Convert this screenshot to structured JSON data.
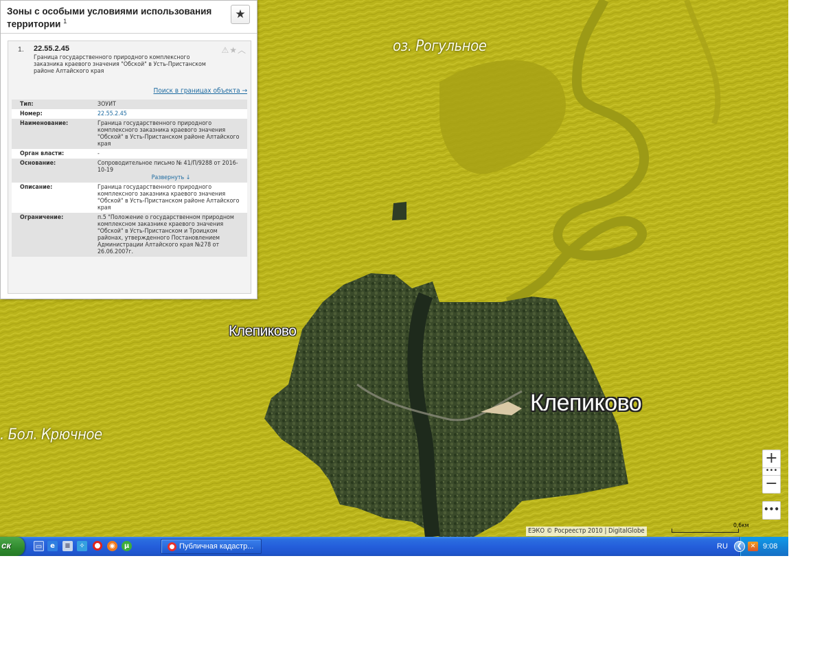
{
  "panel": {
    "title": "Зоны с особыми условиями использования территории",
    "title_sup": "1",
    "star_icon": "star-icon",
    "item": {
      "index": "1.",
      "code": "22.55.2.45",
      "description": "Граница государственного природного комплексного заказника краевого значения \"Обской\" в Усть-Пристанском районе Алтайского края",
      "search_link": "Поиск в границах объекта →",
      "icons": [
        "warning-icon",
        "star-icon",
        "chevron-up-icon"
      ],
      "fields": {
        "type_label": "Тип:",
        "type_value": "ЗОУИТ",
        "number_label": "Номер:",
        "number_value": "22.55.2.45",
        "name_label": "Наименование:",
        "name_value": "Граница государственного природного комплексного заказника краевого значения \"Обской\" в Усть-Пристанском районе Алтайского края",
        "authority_label": "Орган власти:",
        "authority_value": "-",
        "basis_label": "Основание:",
        "basis_value": "Сопроводительное письмо № 41/П/9288 от 2016-10-19",
        "expand_label": "Развернуть ↓",
        "description_label": "Описание:",
        "description_value": "Граница государственного природного комплексного заказника краевого значения \"Обской\" в Усть-Пристанском районе Алтайского края",
        "restriction_label": "Ограничение:",
        "restriction_value": "п.5 \"Положение о государственном природном комплексном заказнике краевого значения \"Обской\" в Усть-Пристанском и Троицком районах, утвержденного Постановлением Администрации Алтайского края №278 от 26.06.2007г."
      }
    }
  },
  "map": {
    "labels": {
      "lake_rogulnoe": "оз. Рогульное",
      "lake_kryuchnoe": ". Бол. Крючное",
      "village_small": "Клепиково",
      "village_large": "Клепиково"
    },
    "controls": {
      "zoom_in": "+",
      "zoom_dots": "•••",
      "zoom_out": "−",
      "more": "•••"
    },
    "copyright": "ЕЭКО © Росреестр 2010 | DigitalGlobe",
    "scale_label": "0,6км",
    "colors": {
      "zone_fill": "#b9b31a",
      "satellite": "#3c4a2c",
      "river": "#9c9a16"
    }
  },
  "taskbar": {
    "start_label": "ск",
    "quick_launch": [
      "show-desktop-icon",
      "ie-icon",
      "notepad-icon",
      "network-icon",
      "opera-icon",
      "firefox-icon",
      "utorrent-icon"
    ],
    "task_title": "Публичная кадастр...",
    "lang": "RU",
    "clock": "9:08"
  }
}
